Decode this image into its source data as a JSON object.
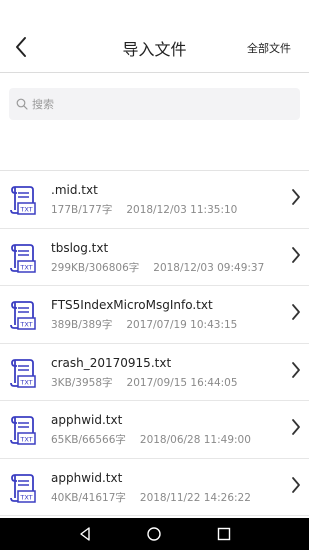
{
  "header": {
    "title": "导入文件",
    "all_files": "全部文件"
  },
  "search": {
    "placeholder": "搜索"
  },
  "files": [
    {
      "name": ".mid.txt",
      "size": "177B/177字",
      "date": "2018/12/03 11:35:10"
    },
    {
      "name": "tbslog.txt",
      "size": "299KB/306806字",
      "date": "2018/12/03 09:49:37"
    },
    {
      "name": "FTS5IndexMicroMsgInfo.txt",
      "size": "389B/389字",
      "date": "2017/07/19 10:43:15"
    },
    {
      "name": "crash_20170915.txt",
      "size": "3KB/3958字",
      "date": "2017/09/15 16:44:05"
    },
    {
      "name": "apphwid.txt",
      "size": "65KB/66566字",
      "date": "2018/06/28 11:49:00"
    },
    {
      "name": "apphwid.txt",
      "size": "40KB/41617字",
      "date": "2018/11/22 14:26:22"
    }
  ],
  "file_icon_label": "TXT",
  "colors": {
    "icon_blue": "#3b3ec2",
    "navbar": "#000000"
  },
  "icons": {
    "back": "chevron-left",
    "search": "magnifier",
    "file": "txt-scroll",
    "row_arrow": "chevron-right"
  }
}
